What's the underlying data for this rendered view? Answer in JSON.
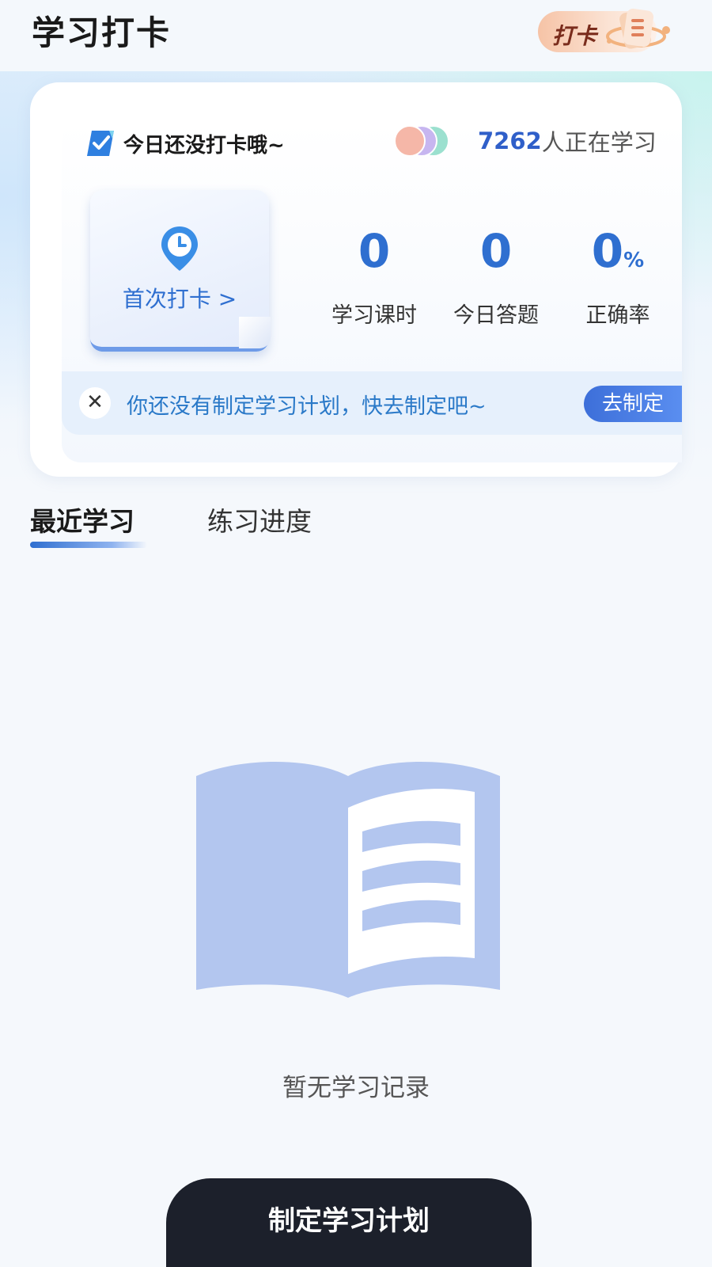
{
  "header": {
    "title": "学习打卡",
    "badge_label": "打卡"
  },
  "card": {
    "status_text": "今日还没打卡哦~",
    "learners_count": "7262",
    "learners_suffix": "人正在学习",
    "first_checkin_label": "首次打卡 >",
    "stats": [
      {
        "value": "0",
        "unit": "",
        "label": "学习课时"
      },
      {
        "value": "0",
        "unit": "",
        "label": "今日答题"
      },
      {
        "value": "0",
        "unit": "%",
        "label": "正确率"
      }
    ],
    "plan_prompt": "你还没有制定学习计划，快去制定吧~",
    "plan_button": "去制定"
  },
  "tabs": [
    {
      "label": "最近学习",
      "active": true
    },
    {
      "label": "练习进度",
      "active": false
    }
  ],
  "empty_state": {
    "icon": "open-book-icon",
    "text": "暂无学习记录"
  },
  "bottom_button": "制定学习计划",
  "colors": {
    "accent": "#2f6fd0",
    "plan_text": "#2a79c8",
    "bottom_button_bg": "#1c202b",
    "illustration": "#b3c6ef"
  }
}
